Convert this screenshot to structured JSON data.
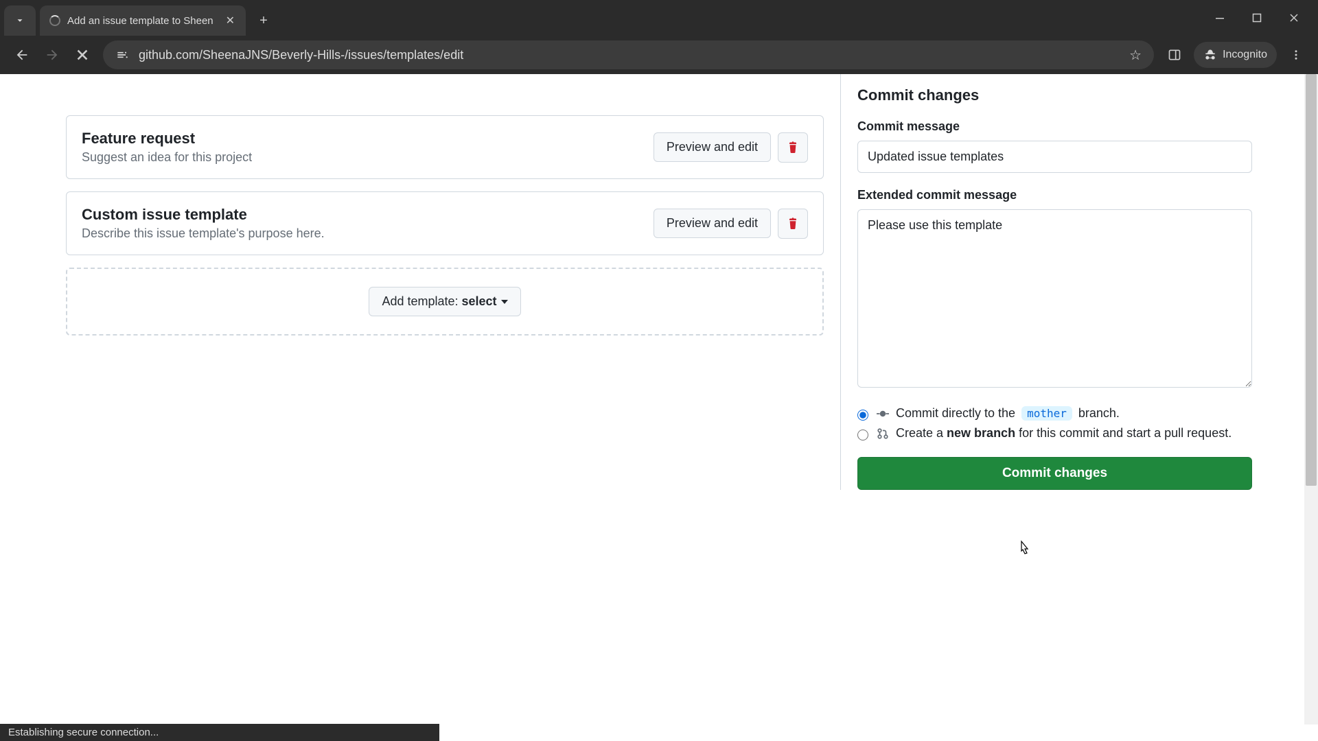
{
  "browser": {
    "tab_title": "Add an issue template to Sheen",
    "url": "github.com/SheenaJNS/Beverly-Hills-/issues/templates/edit",
    "incognito_label": "Incognito",
    "status_text": "Establishing secure connection..."
  },
  "templates": [
    {
      "title": "Feature request",
      "desc": "Suggest an idea for this project",
      "preview_label": "Preview and edit"
    },
    {
      "title": "Custom issue template",
      "desc": "Describe this issue template's purpose here.",
      "preview_label": "Preview and edit"
    }
  ],
  "add_template": {
    "prefix": "Add template: ",
    "select": "select"
  },
  "commit": {
    "panel_title": "Commit changes",
    "message_label": "Commit message",
    "message_value": "Updated issue templates",
    "ext_label": "Extended commit message",
    "ext_value": "Please use this template",
    "direct_prefix": "Commit directly to the ",
    "branch_name": "mother",
    "direct_suffix": " branch.",
    "newbranch_prefix": "Create a ",
    "newbranch_bold": "new branch",
    "newbranch_suffix": " for this commit and start a pull request.",
    "button_label": "Commit changes"
  }
}
